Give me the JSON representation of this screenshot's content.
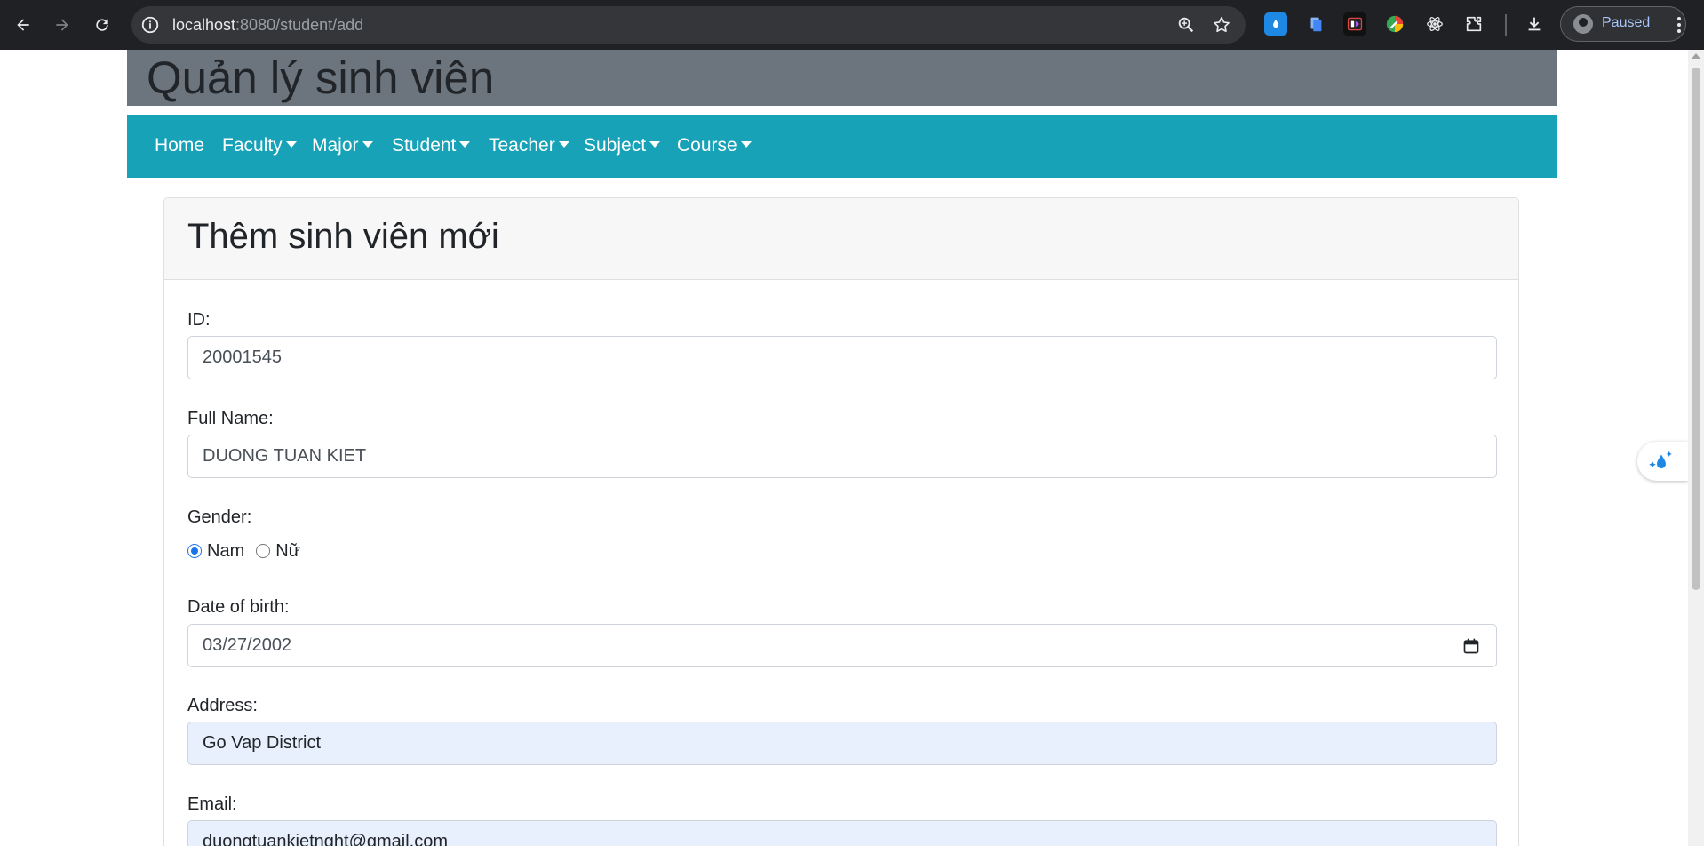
{
  "browser": {
    "url_host": "localhost",
    "url_path": ":8080/student/add",
    "profile_status": "Paused"
  },
  "app": {
    "title": "Quản lý sinh viên"
  },
  "navbar": {
    "items": [
      {
        "label": "Home",
        "dropdown": false
      },
      {
        "label": "Faculty",
        "dropdown": true
      },
      {
        "label": "Major",
        "dropdown": true
      },
      {
        "label": "Student",
        "dropdown": true
      },
      {
        "label": "Teacher",
        "dropdown": true
      },
      {
        "label": "Subject",
        "dropdown": true
      },
      {
        "label": "Course",
        "dropdown": true
      }
    ]
  },
  "form": {
    "title": "Thêm sinh viên mới",
    "id_label": "ID:",
    "id_value": "20001545",
    "fullname_label": "Full Name:",
    "fullname_value": "DUONG TUAN KIET",
    "gender_label": "Gender:",
    "gender_options": [
      "Nam",
      "Nữ"
    ],
    "gender_selected": "Nam",
    "dob_label": "Date of birth:",
    "dob_value": "03/27/2002",
    "address_label": "Address:",
    "address_value": "Go Vap District",
    "email_label": "Email:",
    "email_value": "duongtuankietnght@gmail.com"
  },
  "colors": {
    "header_bg": "#6c757d",
    "navbar_bg": "#17a2b8",
    "autofill_bg": "#e8f0fe"
  }
}
